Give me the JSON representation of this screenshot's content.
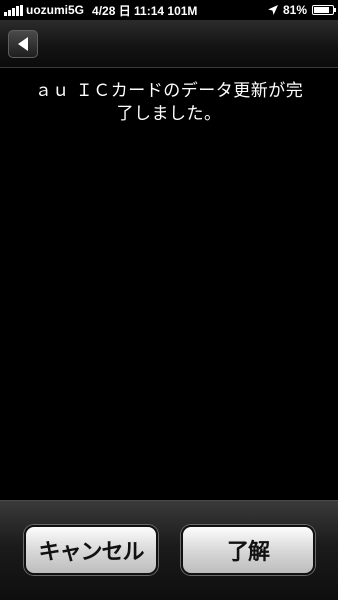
{
  "status_bar": {
    "carrier": "uozumi5G",
    "datetime": "4/28 日 11:14 101M",
    "battery": "81%",
    "battery_level": 0.81
  },
  "nav": {
    "back_icon": "left-arrow-icon"
  },
  "message": {
    "line1": "ａｕ ＩＣカードのデータ更新が完",
    "line2": "了しました。"
  },
  "buttons": {
    "cancel": "キャンセル",
    "ok": "了解"
  },
  "colors": {
    "background": "#000000",
    "button_face": "#e6e6e6"
  }
}
